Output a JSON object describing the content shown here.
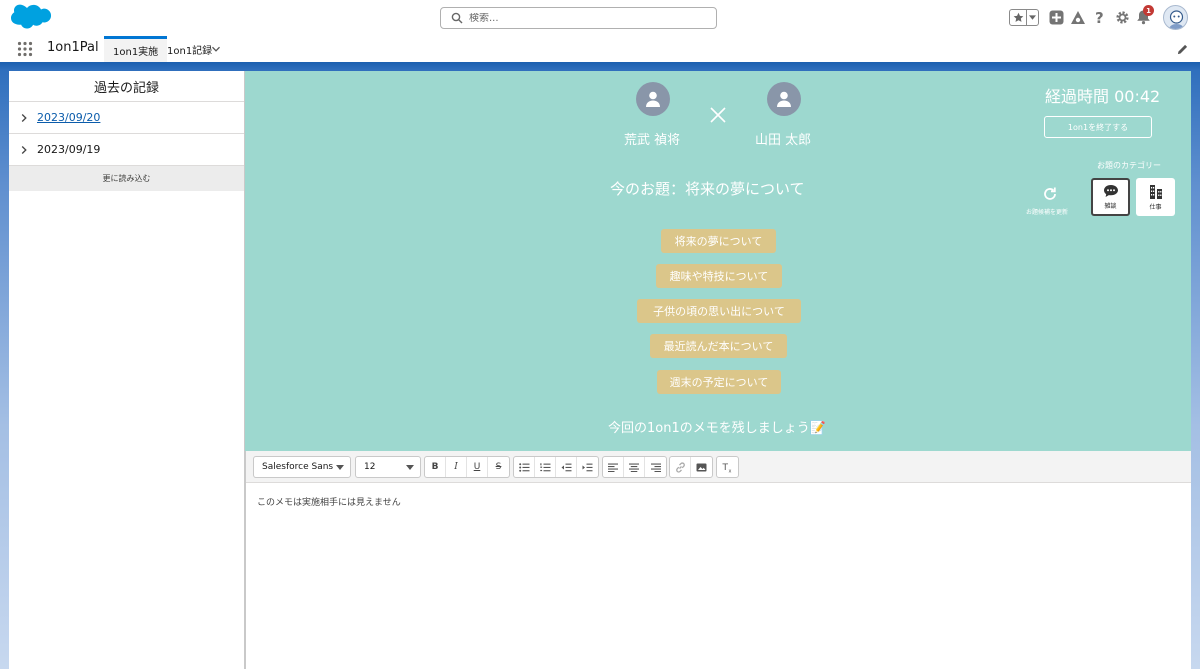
{
  "header": {
    "search_placeholder": "検索...",
    "notification_count": "1"
  },
  "nav": {
    "app_name": "1on1Pal",
    "tabs": [
      {
        "label": "1on1実施",
        "active": true
      },
      {
        "label": "1on1記録",
        "active": false
      }
    ]
  },
  "history": {
    "title": "過去の記録",
    "records": [
      {
        "date": "2023/09/20",
        "link": true
      },
      {
        "date": "2023/09/19",
        "link": false
      }
    ],
    "load_more": "更に読み込む"
  },
  "session": {
    "person_left": "荒武 禎将",
    "person_right": "山田 太郎",
    "elapsed_label": "経過時間 00:42",
    "end_button": "1on1を終了する",
    "current_topic": "今のお題：将来の夢について",
    "category_label": "お題のカテゴリー",
    "refresh_label": "お題候補を更新",
    "categories": [
      {
        "label": "雑談",
        "icon": "chat-icon",
        "selected": true
      },
      {
        "label": "仕事",
        "icon": "building-icon",
        "selected": false
      }
    ],
    "topics": [
      "将来の夢について",
      "趣味や特技について",
      "子供の頃の思い出について",
      "最近読んだ本について",
      "週末の予定について"
    ],
    "memo_prompt": "今回の1on1のメモを残しましょう📝"
  },
  "editor": {
    "font_family": "Salesforce Sans",
    "font_size": "12",
    "placeholder": "このメモは実施相手には見えません"
  },
  "colors": {
    "teal_panel": "#9dd8cf",
    "chip": "#dbc68a",
    "avatar": "#8996a9",
    "brand_blue": "#0176d3"
  }
}
